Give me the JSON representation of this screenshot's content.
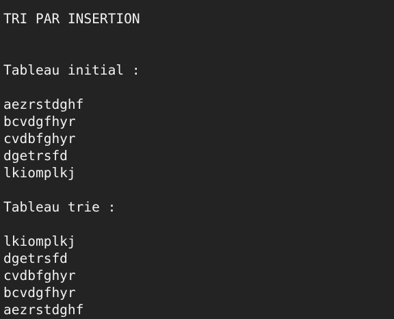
{
  "terminal": {
    "title": "TRI PAR INSERTION",
    "initial_heading": "Tableau initial :",
    "initial_items": [
      "aezrstdghf",
      "bcvdgfhyr",
      "cvdbfghyr",
      "dgetrsfd",
      "lkiomplkj"
    ],
    "sorted_heading": "Tableau trie :",
    "sorted_items": [
      "lkiomplkj",
      "dgetrsfd",
      "cvdbfghyr",
      "bcvdgfhyr",
      "aezrstdghf"
    ]
  }
}
